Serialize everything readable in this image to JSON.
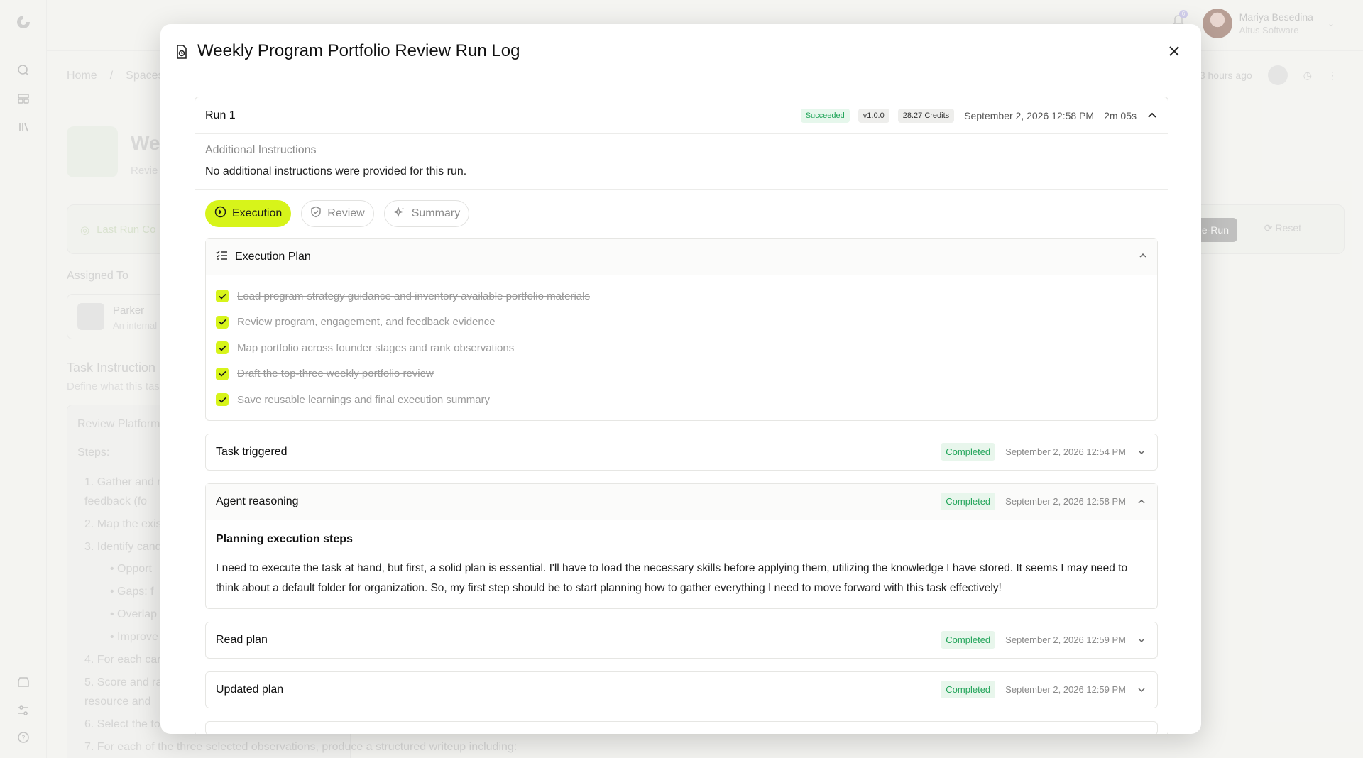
{
  "topbar": {
    "notification_count": "6",
    "user_name": "Mariya Besedina",
    "user_org": "Altus Software"
  },
  "background": {
    "breadcrumbs": [
      "Home",
      "/",
      "Spaces"
    ],
    "title": "We",
    "subtitle": "Revie",
    "last_run": "Last Run Co",
    "meta_time": "3 hours ago",
    "rerun_label": "Re-Run",
    "reset_label": "Reset",
    "assigned_heading": "Assigned To",
    "assignee_name": "Parker",
    "assignee_sub": "An internal",
    "task_instructions_heading": "Task Instruction",
    "task_instructions_sub": "Define what this tas",
    "instruction_lines": [
      "Review Platform",
      "Steps:",
      "1.  Gather and r",
      "     feedback (fo",
      "2.  Map the exis",
      "3.  Identify cand",
      "•  Opport",
      "•  Gaps: f",
      "•  Overlap",
      "•  Improve",
      "4.  For each car",
      "5.  Score and ra",
      "     resource and",
      "6.  Select the to",
      "7.  For each of the three selected observations, produce a structured writeup including:"
    ]
  },
  "modal": {
    "title": "Weekly Program Portfolio Review Run Log",
    "run": {
      "label": "Run 1",
      "status": "Succeeded",
      "version": "v1.0.0",
      "credits": "28.27 Credits",
      "date": "September 2, 2026 12:58 PM",
      "duration": "2m 05s",
      "additional_heading": "Additional Instructions",
      "additional_text": "No additional instructions were provided for this run."
    },
    "tabs": [
      {
        "label": "Execution",
        "icon": "play-circle-icon",
        "active": true
      },
      {
        "label": "Review",
        "icon": "shield-check-icon",
        "active": false
      },
      {
        "label": "Summary",
        "icon": "sparkles-icon",
        "active": false
      }
    ],
    "execution_plan": {
      "title": "Execution Plan",
      "items": [
        "Load program-strategy guidance and inventory available portfolio materials",
        "Review program, engagement, and feedback evidence",
        "Map portfolio across founder stages and rank observations",
        "Draft the top-three weekly portfolio review",
        "Save reusable learnings and final execution summary"
      ]
    },
    "steps": [
      {
        "title": "Task triggered",
        "status": "Completed",
        "date": "September 2, 2026 12:54 PM",
        "expanded": false
      },
      {
        "title": "Agent reasoning",
        "status": "Completed",
        "date": "September 2, 2026 12:58 PM",
        "expanded": true,
        "body_heading": "Planning execution steps",
        "body_text": "I need to execute the task at hand, but first, a solid plan is essential. I'll have to load the necessary skills before applying them, utilizing the knowledge I have stored. It seems I may need to think about a default folder for organization. So, my first step should be to start planning how to gather everything I need to move forward with this task effectively!"
      },
      {
        "title": "Read plan",
        "status": "Completed",
        "date": "September 2, 2026 12:59 PM",
        "expanded": false
      },
      {
        "title": "Updated plan",
        "status": "Completed",
        "date": "September 2, 2026 12:59 PM",
        "expanded": false
      }
    ]
  },
  "colors": {
    "accent": "#d7f41a",
    "success": "#22a55a",
    "success_bg": "#e8f6ec"
  }
}
